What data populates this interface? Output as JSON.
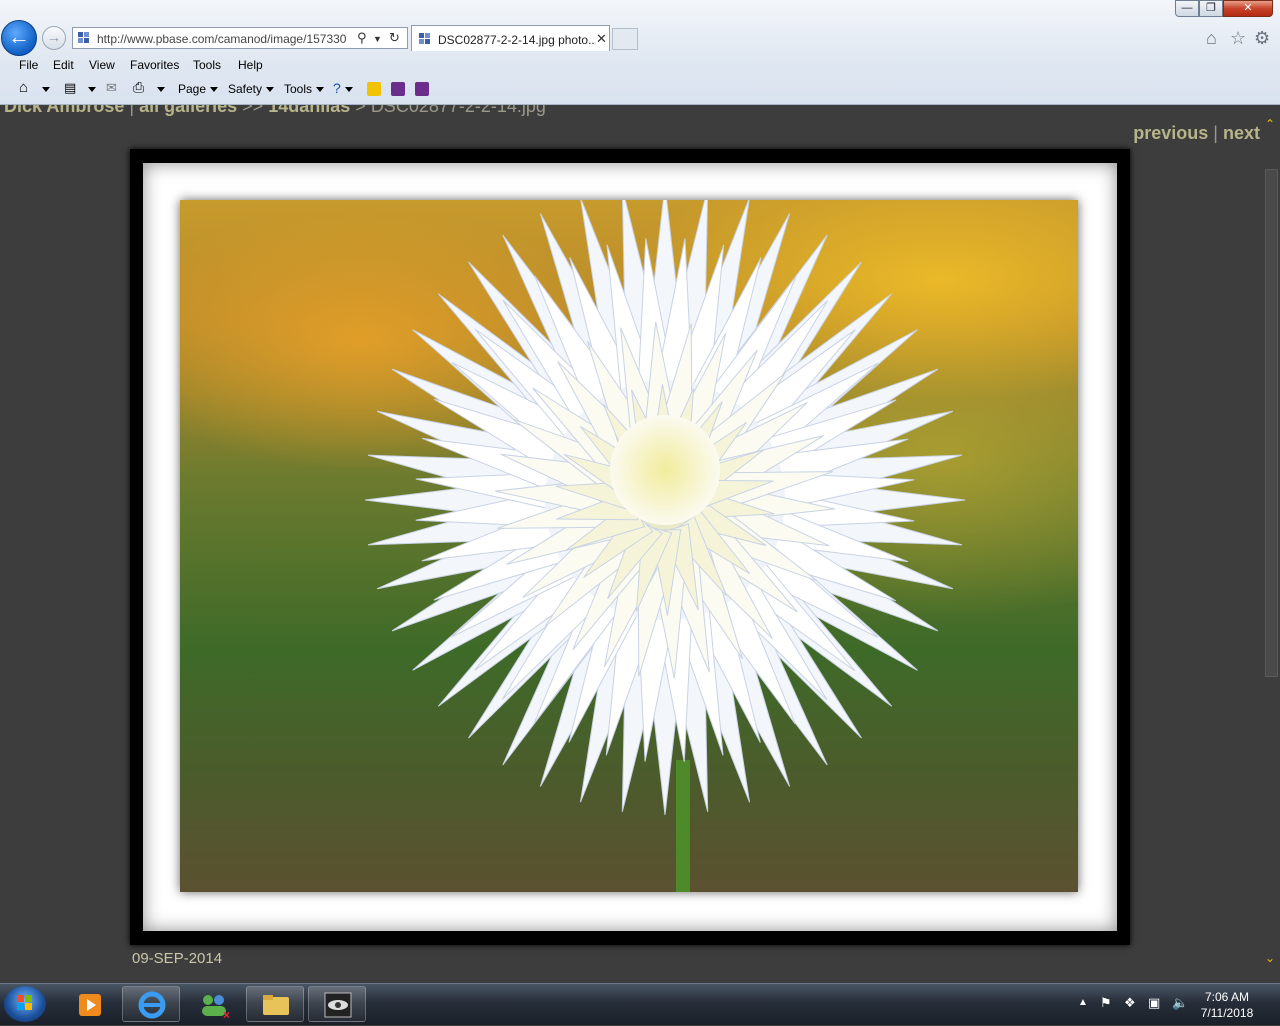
{
  "window": {
    "minimize": "—",
    "maximize": "❐",
    "close": "✕"
  },
  "nav": {
    "back_icon": "arrow-left",
    "forward_icon": "arrow-right"
  },
  "address": {
    "url": "http://www.pbase.com/camanod/image/157330",
    "search_glyph": "⚲",
    "refresh_glyph": "↻"
  },
  "tab": {
    "title": "DSC02877-2-2-14.jpg photo...",
    "close": "✕"
  },
  "menu": [
    "File",
    "Edit",
    "View",
    "Favorites",
    "Tools",
    "Help"
  ],
  "commandbar": {
    "page": "Page",
    "safety": "Safety",
    "tools": "Tools"
  },
  "page": {
    "breadcrumb": {
      "author": "Dick Ambrose",
      "sep1": "|",
      "galleries": "all galleries",
      "sep2": ">>",
      "gallery": "14dahlias",
      "sep3": ">",
      "current": "DSC02877-2-2-14.jpg"
    },
    "previous": "previous",
    "pipe": "|",
    "next": "next",
    "caption": "09-SEP-2014"
  },
  "scrollbar": {
    "up": "⌃",
    "down": "⌄"
  },
  "taskbar": {
    "time": "7:06 AM",
    "date": "7/11/2018"
  },
  "colors": {
    "link": "#b7b48a",
    "page_bg": "#3d3d3d",
    "caption": "#c9c7a7"
  }
}
